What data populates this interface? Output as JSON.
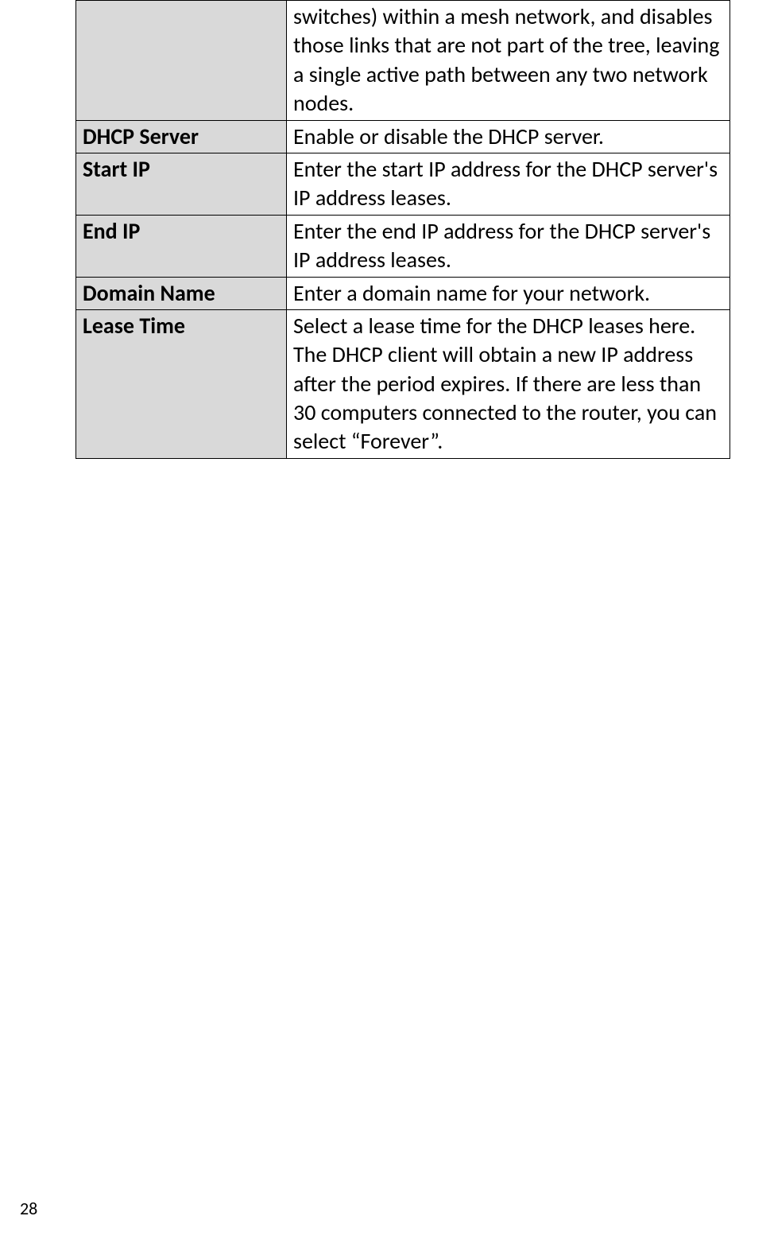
{
  "table": {
    "rows": [
      {
        "label": "",
        "value": "switches) within a mesh network, and disables those links that are not part of the tree, leaving a single active path between any two network nodes."
      },
      {
        "label": "DHCP Server",
        "value": "Enable or disable the DHCP server."
      },
      {
        "label": "Start IP",
        "value": "Enter the start IP address for the DHCP server's IP address leases."
      },
      {
        "label": "End IP",
        "value": "Enter the end IP address for the DHCP server's IP address leases."
      },
      {
        "label": "Domain Name",
        "value": "Enter a domain name for your network."
      },
      {
        "label": "Lease Time",
        "value": "Select a lease time for the DHCP leases here. The DHCP client will obtain a new IP address after the period expires. If there are less than 30 computers connected to the router, you can select “Forever”."
      }
    ]
  },
  "pageNumber": "28"
}
